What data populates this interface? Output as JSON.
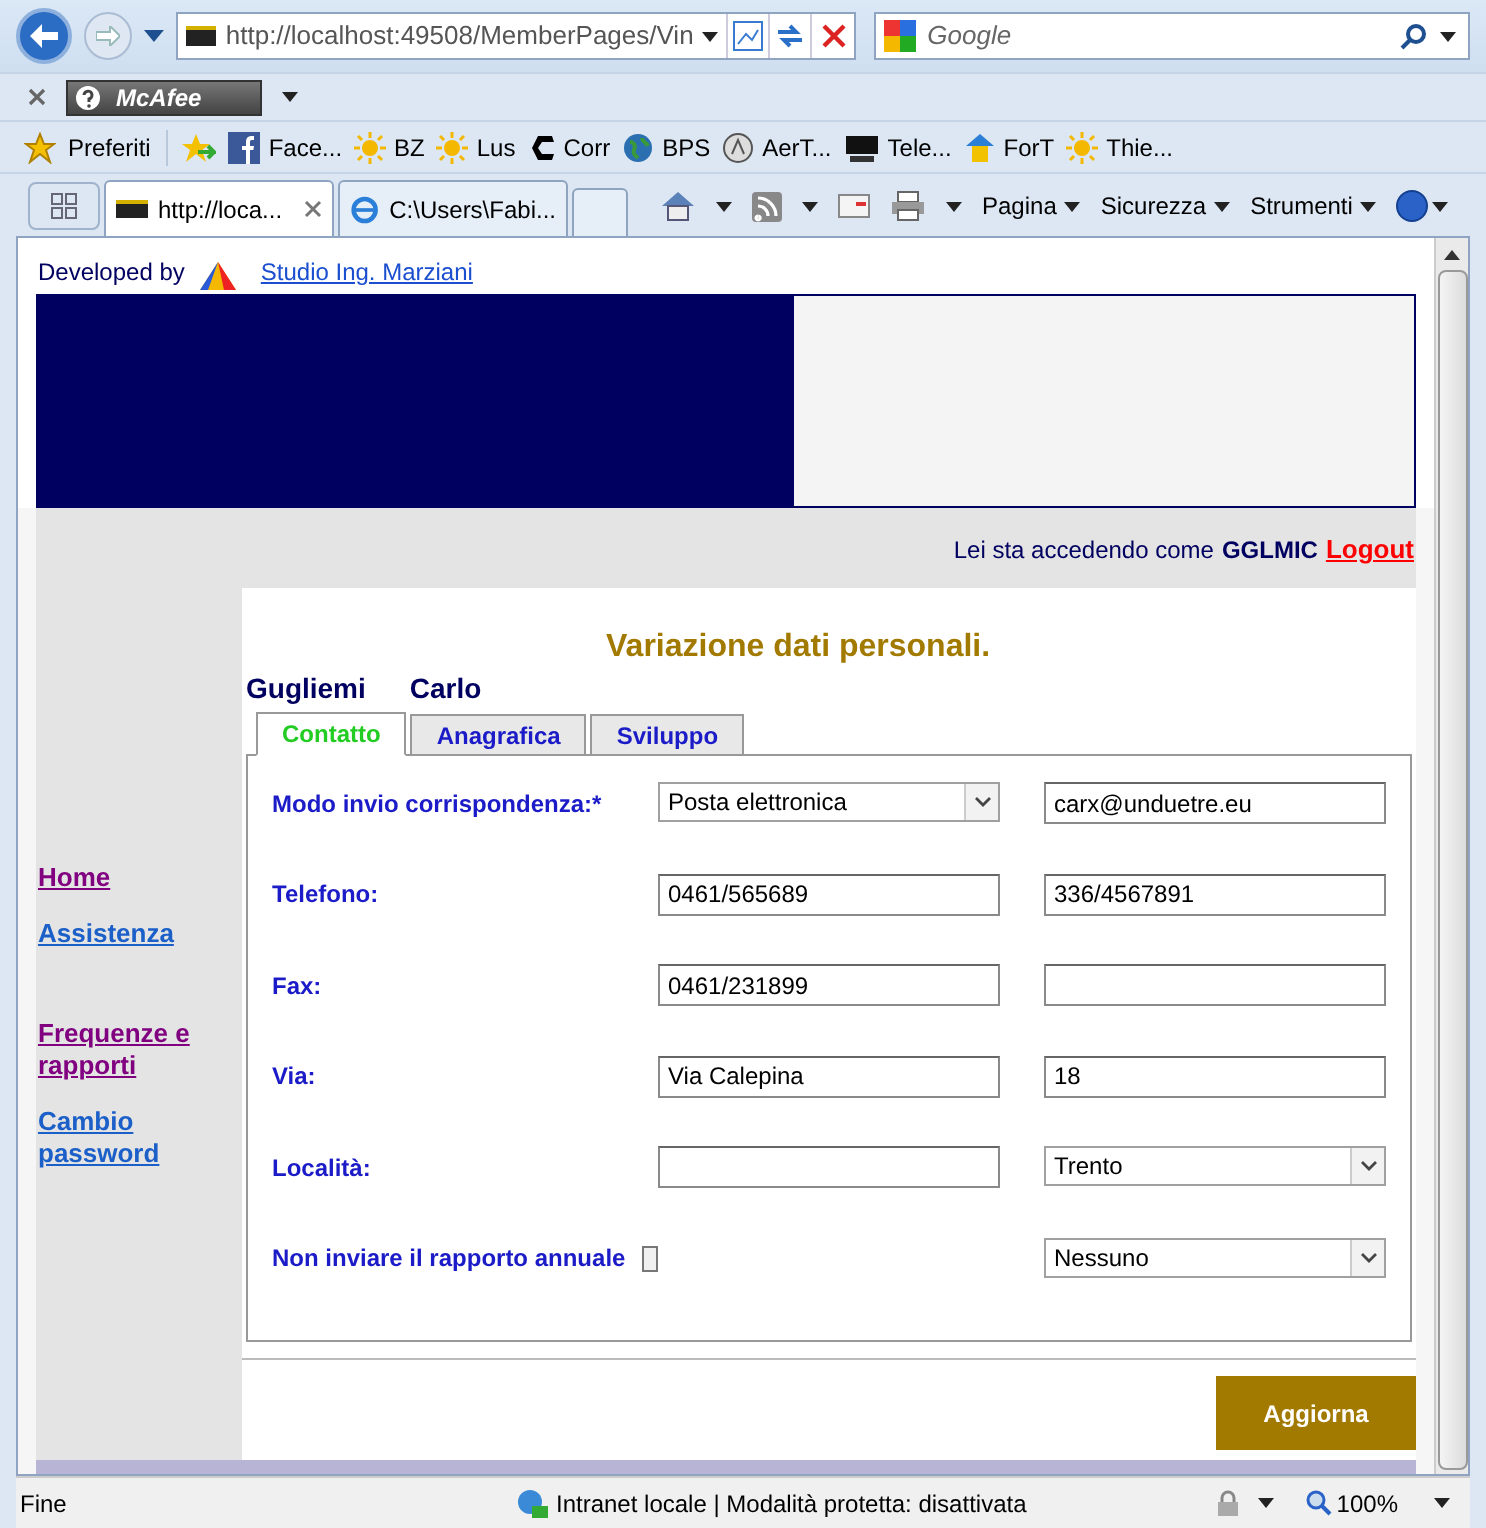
{
  "browser": {
    "address": "http://localhost:49508/MemberPages/Vin",
    "search_placeholder": "Google",
    "security_toolbar": "McAfee",
    "favorites": {
      "label": "Preferiti",
      "items": [
        {
          "label": "Face..."
        },
        {
          "label": "BZ"
        },
        {
          "label": "Lus"
        },
        {
          "label": "Corr"
        },
        {
          "label": "BPS"
        },
        {
          "label": "AerT..."
        },
        {
          "label": "Tele..."
        },
        {
          "label": "ForT"
        },
        {
          "label": "Thie..."
        }
      ]
    },
    "tabs": [
      {
        "label": "http://loca...",
        "selected": true
      },
      {
        "label": "C:\\Users\\Fabi...",
        "selected": false
      }
    ],
    "commands": [
      "Pagina",
      "Sicurezza",
      "Strumenti"
    ]
  },
  "page": {
    "developed_by": "Developed by",
    "developer_link": "Studio Ing. Marziani",
    "login_text": "Lei sta accedendo come",
    "user": "GGLMIC",
    "logout": "Logout",
    "sidebar": [
      {
        "label": "Home",
        "visited": true
      },
      {
        "label": "Assistenza",
        "visited": false
      },
      {
        "label": "Frequenze e rapporti",
        "visited": true
      },
      {
        "label": "Cambio password",
        "visited": false
      }
    ],
    "title": "Variazione dati personali.",
    "surname": "Gugliemi",
    "name": "Carlo",
    "tabs": [
      {
        "label": "Contatto",
        "selected": true
      },
      {
        "label": "Anagrafica",
        "selected": false
      },
      {
        "label": "Sviluppo",
        "selected": false
      }
    ],
    "rows": [
      {
        "label": "Modo invio corrispondenza:",
        "required_mark": "*",
        "fields": [
          {
            "kind": "select",
            "value": "Posta elettronica"
          },
          {
            "kind": "input",
            "value": "carx@unduetre.eu"
          }
        ]
      },
      {
        "label": "Telefono:",
        "fields": [
          {
            "kind": "input",
            "value": "0461/565689"
          },
          {
            "kind": "input",
            "value": "336/4567891"
          }
        ]
      },
      {
        "label": "Fax:",
        "fields": [
          {
            "kind": "input",
            "value": "0461/231899"
          },
          {
            "kind": "input"
          }
        ]
      },
      {
        "label": "Via:",
        "fields": [
          {
            "kind": "input",
            "value": "Via Calepina"
          },
          {
            "kind": "input",
            "value": "18"
          }
        ]
      },
      {
        "label": "Località:",
        "fields": [
          {
            "kind": "input"
          },
          {
            "kind": "select",
            "value": "Trento"
          }
        ]
      },
      {
        "label": "Non inviare il rapporto annuale",
        "fields": [
          {
            "kind": "checkbox",
            "checked": false
          },
          {
            "kind": "select",
            "value": "Nessuno"
          }
        ]
      }
    ],
    "submit": "Aggiorna"
  },
  "status_bar": {
    "status": "Fine",
    "zone": "Intranet locale | Modalità protetta: disattivata",
    "zoom": "100%"
  }
}
